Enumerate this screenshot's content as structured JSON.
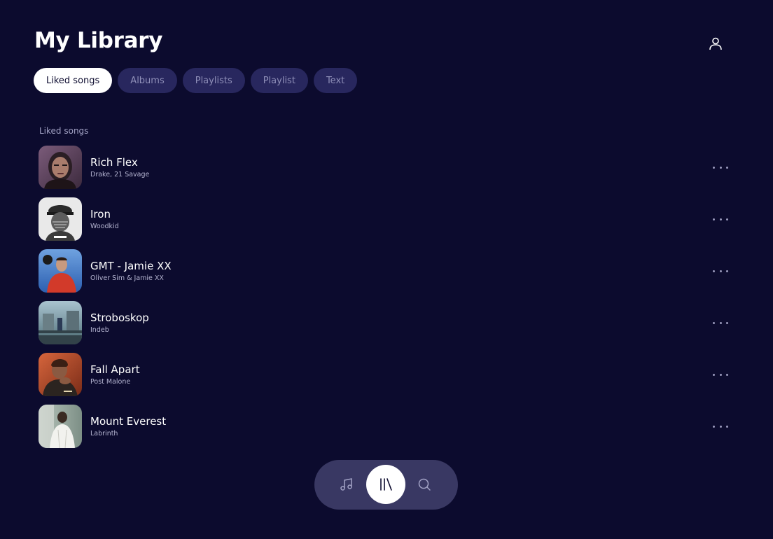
{
  "header": {
    "title": "My Library"
  },
  "tabs": [
    {
      "label": "Liked songs",
      "active": true
    },
    {
      "label": "Albums",
      "active": false
    },
    {
      "label": "Playlists",
      "active": false
    },
    {
      "label": "Playlist",
      "active": false
    },
    {
      "label": "Text",
      "active": false
    }
  ],
  "section": {
    "label": "Liked songs"
  },
  "songs": [
    {
      "title": "Rich Flex",
      "artist": "Drake, 21 Savage"
    },
    {
      "title": "Iron",
      "artist": "Woodkid"
    },
    {
      "title": "GMT - Jamie XX",
      "artist": "Oliver Sim & Jamie XX"
    },
    {
      "title": "Stroboskop",
      "artist": "Indeb"
    },
    {
      "title": "Fall Apart",
      "artist": "Post Malone"
    },
    {
      "title": "Mount Everest",
      "artist": "Labrinth"
    }
  ],
  "nav": {
    "items": [
      {
        "icon": "music-note-icon",
        "active": false
      },
      {
        "icon": "library-icon",
        "active": true
      },
      {
        "icon": "search-icon",
        "active": false
      }
    ]
  },
  "colors": {
    "background": "#0c0b2e",
    "tab_inactive": "#28275e",
    "nav_bar": "#393863",
    "accent": "#ffffff"
  }
}
